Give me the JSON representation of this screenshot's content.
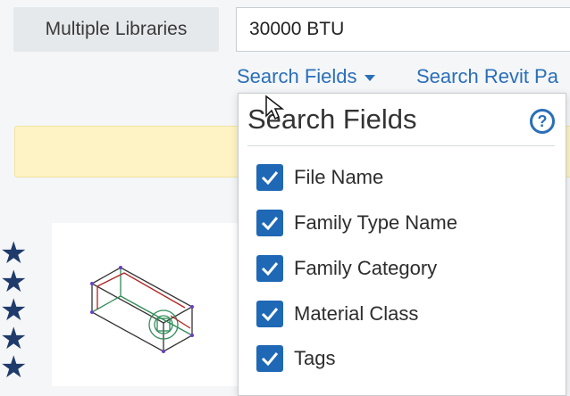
{
  "library_selector": {
    "label": "Multiple Libraries"
  },
  "search": {
    "value": "30000 BTU"
  },
  "links": {
    "search_fields": "Search Fields",
    "search_revit": "Search Revit Pa"
  },
  "dropdown": {
    "title": "Search Fields",
    "help_icon": "?",
    "options": [
      {
        "label": "File Name",
        "checked": true
      },
      {
        "label": "Family Type Name",
        "checked": true
      },
      {
        "label": "Family Category",
        "checked": true
      },
      {
        "label": "Material Class",
        "checked": true
      },
      {
        "label": "Tags",
        "checked": true
      }
    ]
  },
  "rating": {
    "stars": 5,
    "star_glyph": "★"
  },
  "colors": {
    "accent": "#2a6fb8",
    "checkbox": "#1f68b5",
    "alert": "#fdf3c4",
    "star": "#1f3b6b"
  }
}
